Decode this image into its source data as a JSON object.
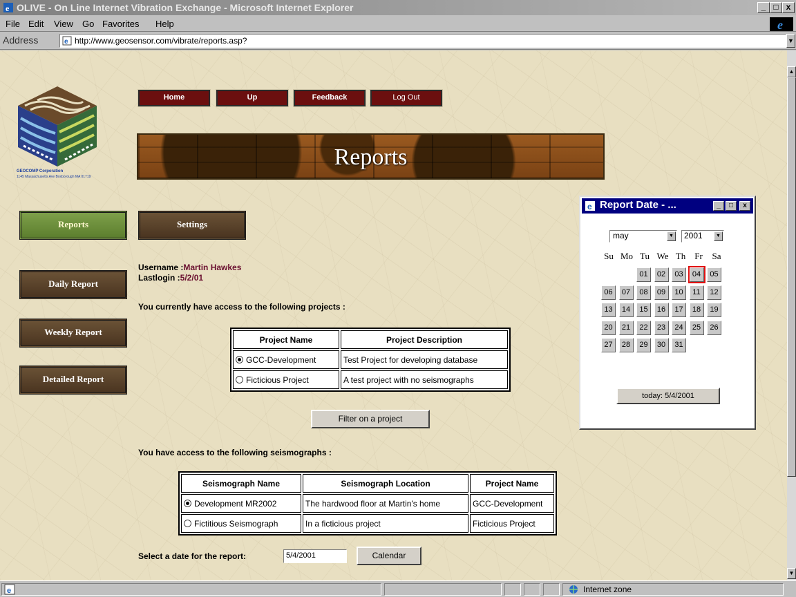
{
  "window": {
    "title": "OLIVE - On Line Internet Vibration Exchange - Microsoft Internet Explorer",
    "buttons": {
      "min": "_",
      "max": "□",
      "close": "x"
    }
  },
  "menu": [
    "File",
    "Edit",
    "View",
    "Go",
    "Favorites",
    "Help"
  ],
  "address": {
    "label": "Address",
    "url": "http://www.geosensor.com/vibrate/reports.asp?"
  },
  "logo": {
    "company": "GEOCOMP Corporation",
    "address_line": "1145 Massachusetts Ave Boxborough MA 01719"
  },
  "nav": {
    "home": "Home",
    "up": "Up",
    "feedback": "Feedback",
    "logout": "Log Out"
  },
  "banner": {
    "title": "Reports"
  },
  "tabs": {
    "reports": "Reports",
    "settings": "Settings"
  },
  "sidebar": {
    "daily": "Daily Report",
    "weekly": "Weekly Report",
    "detailed": "Detailed Report"
  },
  "user": {
    "username_label": "Username :",
    "username": "Martin Hawkes",
    "lastlogin_label": "Lastlogin :",
    "lastlogin": "5/2/01"
  },
  "projects": {
    "intro": "You currently have access to the following projects :",
    "headers": [
      "Project Name",
      "Project Description"
    ],
    "rows": [
      {
        "name": "GCC-Development",
        "description": "Test Project for developing database",
        "selected": true
      },
      {
        "name": "Ficticious Project",
        "description": "A test project with no seismographs",
        "selected": false
      }
    ],
    "filter_button": "Filter on a project"
  },
  "seismographs": {
    "intro": "You have access to the following seismographs :",
    "headers": [
      "Seismograph Name",
      "Seismograph Location",
      "Project Name"
    ],
    "rows": [
      {
        "name": "Development MR2002",
        "location": "The hardwood floor at Martin's home",
        "project": "GCC-Development",
        "selected": true
      },
      {
        "name": "Fictitious Seismograph",
        "location": "In a ficticious project",
        "project": "Ficticious Project",
        "selected": false
      }
    ]
  },
  "date_select": {
    "label": "Select a date for the report:",
    "value": "5/4/2001",
    "calendar_button": "Calendar"
  },
  "popup": {
    "title": "Report Date - ...",
    "month": "may",
    "year": "2001",
    "weekdays": [
      "Su",
      "Mo",
      "Tu",
      "We",
      "Th",
      "Fr",
      "Sa"
    ],
    "first_weekday": 2,
    "days": [
      "01",
      "02",
      "03",
      "04",
      "05",
      "06",
      "07",
      "08",
      "09",
      "10",
      "11",
      "12",
      "13",
      "14",
      "15",
      "16",
      "17",
      "18",
      "19",
      "20",
      "21",
      "22",
      "23",
      "24",
      "25",
      "26",
      "27",
      "28",
      "29",
      "30",
      "31"
    ],
    "selected_day": "04",
    "today_button": "today: 5/4/2001"
  },
  "status": {
    "zone": "Internet zone"
  }
}
